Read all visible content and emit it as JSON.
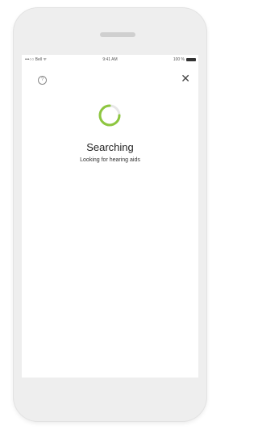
{
  "status_bar": {
    "carrier": "•••○○ Bell ᯤ",
    "time": "9:41 AM",
    "battery": "100 %"
  },
  "header": {
    "help_symbol": "?",
    "close_symbol": "✕"
  },
  "main": {
    "title": "Searching",
    "subtitle": "Looking for hearing aids",
    "spinner_color": "#8dc63f"
  },
  "icons": {
    "help": "question-circle-icon",
    "close": "close-icon",
    "spinner": "loading-spinner-icon"
  }
}
